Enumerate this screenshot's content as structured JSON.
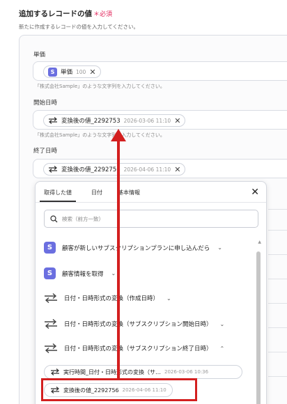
{
  "section": {
    "title": "追加するレコードの値",
    "required": "＊必須",
    "subtitle": "新たに作成するレコードの値を入力してください。"
  },
  "fields": [
    {
      "label": "単価",
      "chip_badge": "S",
      "chip_label": "単価",
      "chip_meta": "100",
      "hint": "「株式会社Sample」のような文字列を入力してください。"
    },
    {
      "label": "開始日時",
      "chip_label": "変換後の値_2292753",
      "chip_meta": "2026-03-06 11:10",
      "hint": "「株式会社Sample」のような文字列を入力してください。"
    },
    {
      "label": "終了日時",
      "chip_label": "変換後の値_2292756",
      "chip_meta": "2026-04-06 11:10"
    }
  ],
  "dropdown": {
    "tabs": [
      "取得した値",
      "日付",
      "基本情報"
    ],
    "search_placeholder": "検索（前方一致）",
    "items": [
      {
        "icon": "S",
        "label": "顧客が新しいサブスクリプションプランに申し込んだら",
        "chevron": "⌄"
      },
      {
        "icon": "S",
        "label": "顧客情報を取得",
        "chevron": "⌄"
      },
      {
        "icon": "swap",
        "label": "日付・日時形式の変換（作成日時）",
        "chevron": "⌄"
      },
      {
        "icon": "swap",
        "label": "日付・日時形式の変換（サブスクリプション開始日時）",
        "chevron": "⌄"
      },
      {
        "icon": "swap",
        "label": "日付・日時形式の変換（サブスクリプション終了日時）",
        "chevron": "⌃"
      }
    ],
    "sub_items": [
      {
        "label": "実行時間_日付・日時形式の変換（サ…",
        "meta": "2026-03-06 10:36"
      },
      {
        "label": "変換後の値_2292756",
        "meta": "2026-04-06 11:10"
      }
    ]
  },
  "colors": {
    "accent_badge": "#6b6fe0",
    "required": "#e2245a",
    "annotation": "#d31f1f"
  }
}
